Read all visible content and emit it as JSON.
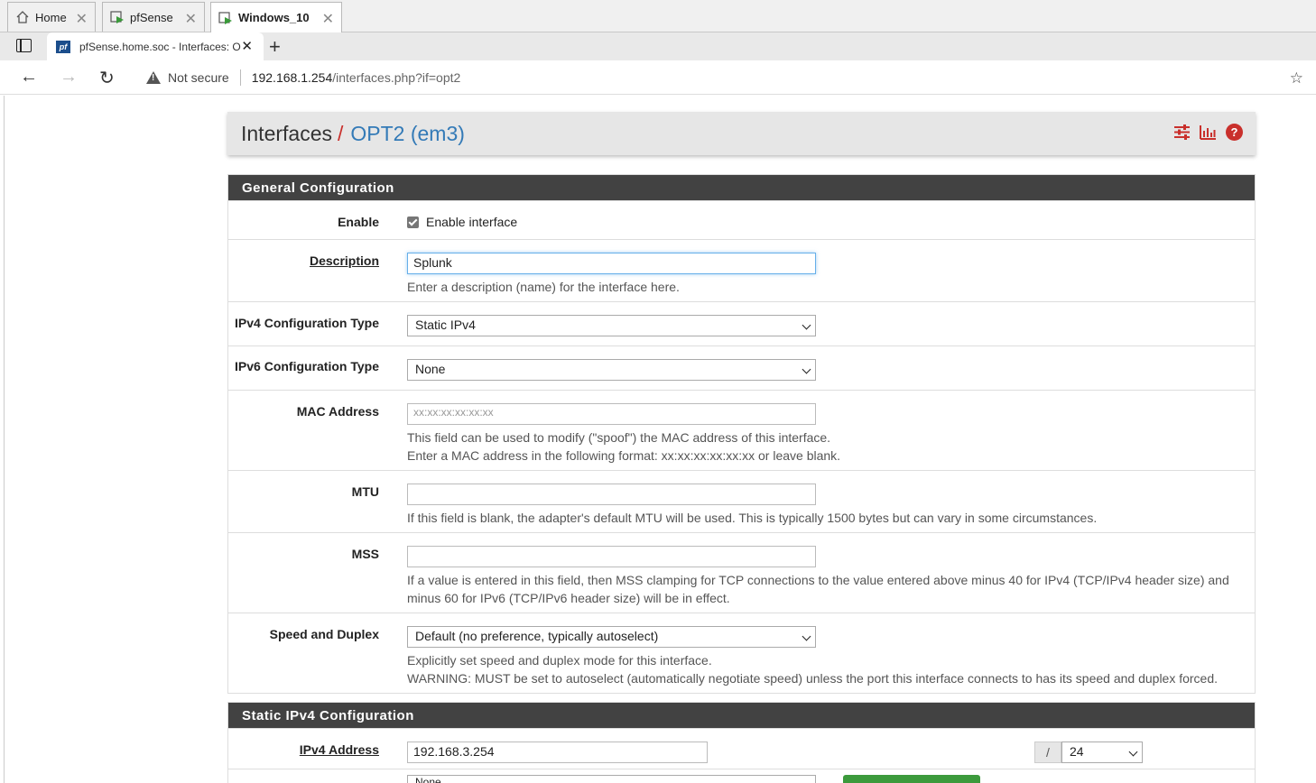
{
  "vm_tabs": [
    {
      "label": "Home",
      "active": false
    },
    {
      "label": "pfSense",
      "active": false
    },
    {
      "label": "Windows_10",
      "active": true
    }
  ],
  "browser": {
    "tab_title": "pfSense.home.soc - Interfaces: O",
    "not_secure": "Not secure",
    "url_host": "192.168.1.254",
    "url_path": "/interfaces.php?if=opt2"
  },
  "header": {
    "crumb_root": "Interfaces",
    "crumb_sep": "/",
    "crumb_current": "OPT2 (em3)"
  },
  "general": {
    "title": "General Configuration",
    "enable_label": "Enable",
    "enable_text": "Enable interface",
    "enable_checked": true,
    "description_label": "Description",
    "description_value": "Splunk",
    "description_help": "Enter a description (name) for the interface here.",
    "ipv4_type_label": "IPv4 Configuration Type",
    "ipv4_type_value": "Static IPv4",
    "ipv6_type_label": "IPv6 Configuration Type",
    "ipv6_type_value": "None",
    "mac_label": "MAC Address",
    "mac_placeholder": "xx:xx:xx:xx:xx:xx",
    "mac_help_1": "This field can be used to modify (\"spoof\") the MAC address of this interface.",
    "mac_help_2": "Enter a MAC address in the following format: xx:xx:xx:xx:xx:xx or leave blank.",
    "mtu_label": "MTU",
    "mtu_help": "If this field is blank, the adapter's default MTU will be used. This is typically 1500 bytes but can vary in some circumstances.",
    "mss_label": "MSS",
    "mss_help_1": "If a value is entered in this field, then MSS clamping for TCP connections to the value entered above minus 40 for IPv4 (TCP/IPv4 header size) and",
    "mss_help_2": "minus 60 for IPv6 (TCP/IPv6 header size) will be in effect.",
    "speed_label": "Speed and Duplex",
    "speed_value": "Default (no preference, typically autoselect)",
    "speed_help_1": "Explicitly set speed and duplex mode for this interface.",
    "speed_help_2": "WARNING: MUST be set to autoselect (automatically negotiate speed) unless the port this interface connects to has its speed and duplex forced."
  },
  "static_ipv4": {
    "title": "Static IPv4 Configuration",
    "ipv4_label": "IPv4 Address",
    "ipv4_value": "192.168.3.254",
    "slash": "/",
    "cidr_value": "24",
    "gateway_value": "None"
  }
}
